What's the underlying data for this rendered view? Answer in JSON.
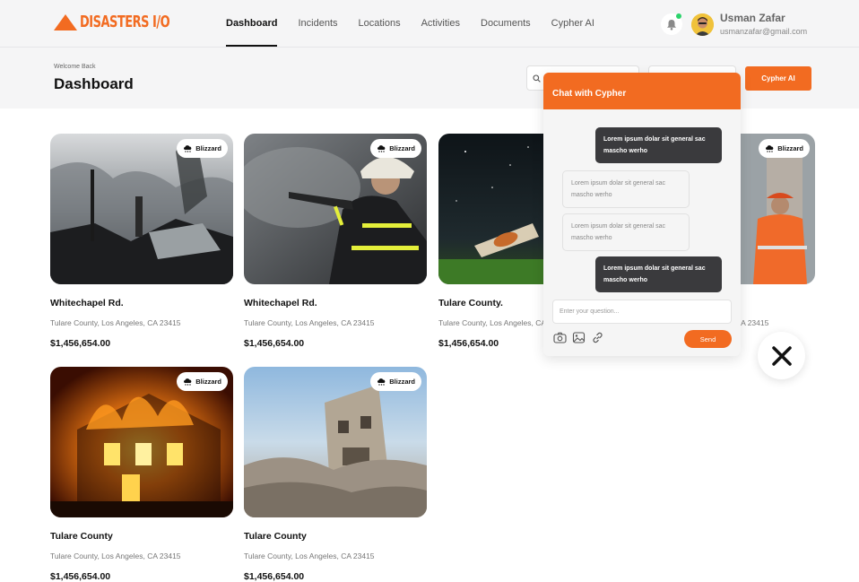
{
  "brand": {
    "name": "DISASTERS I/O",
    "accent": "#f26b21"
  },
  "nav": {
    "items": [
      {
        "label": "Dashboard",
        "active": true
      },
      {
        "label": "Incidents",
        "active": false
      },
      {
        "label": "Locations",
        "active": false
      },
      {
        "label": "Activities",
        "active": false
      },
      {
        "label": "Documents",
        "active": false
      },
      {
        "label": "Cypher AI",
        "active": false
      }
    ]
  },
  "user": {
    "name": "Usman Zafar",
    "email": "usmanzafar@gmail.com"
  },
  "header": {
    "welcome": "Welcome Back",
    "title": "Dashboard",
    "cta_label": "Cypher AI"
  },
  "cards": [
    {
      "badge": "Blizzard",
      "title": "Whitechapel Rd.",
      "address": "Tulare County, Los Angeles, CA 23415",
      "price": "$1,456,654.00",
      "scene": "burned-debris"
    },
    {
      "badge": "Blizzard",
      "title": "Whitechapel Rd.",
      "address": "Tulare County, Los Angeles, CA 23415",
      "price": "$1,456,654.00",
      "scene": "firefighter"
    },
    {
      "badge": "",
      "title": "Tulare County.",
      "address": "Tulare County, Los Angeles, CA 23415",
      "price": "$1,456,654.00",
      "scene": "night-crash"
    },
    {
      "badge": "Blizzard",
      "title": "",
      "address": "CA 23415",
      "price": "",
      "scene": "rescue-worker"
    },
    {
      "badge": "Blizzard",
      "title": "Tulare County",
      "address": "Tulare County, Los Angeles, CA 23415",
      "price": "$1,456,654.00",
      "scene": "house-fire"
    },
    {
      "badge": "Blizzard",
      "title": "Tulare County",
      "address": "Tulare County, Los Angeles, CA 23415",
      "price": "$1,456,654.00",
      "scene": "rubble"
    }
  ],
  "chat": {
    "title": "Chat with Cypher",
    "messages": [
      {
        "from": "user",
        "text": "Lorem ipsum dolar sit general sac mascho werho"
      },
      {
        "from": "bot",
        "text": "Lorem ipsum dolar sit general sac mascho werho"
      },
      {
        "from": "bot",
        "text": "Lorem ipsum dolar sit general sac mascho werho"
      },
      {
        "from": "user",
        "text": "Lorem ipsum dolar sit general sac mascho werho"
      }
    ],
    "input_placeholder": "Enter your question...",
    "send_label": "Send",
    "tools": [
      "camera-icon",
      "image-icon",
      "link-icon"
    ]
  },
  "icons": {
    "bell": "bell-icon",
    "search": "search-icon",
    "close": "close-icon",
    "badge": "cloud-snow-icon"
  }
}
